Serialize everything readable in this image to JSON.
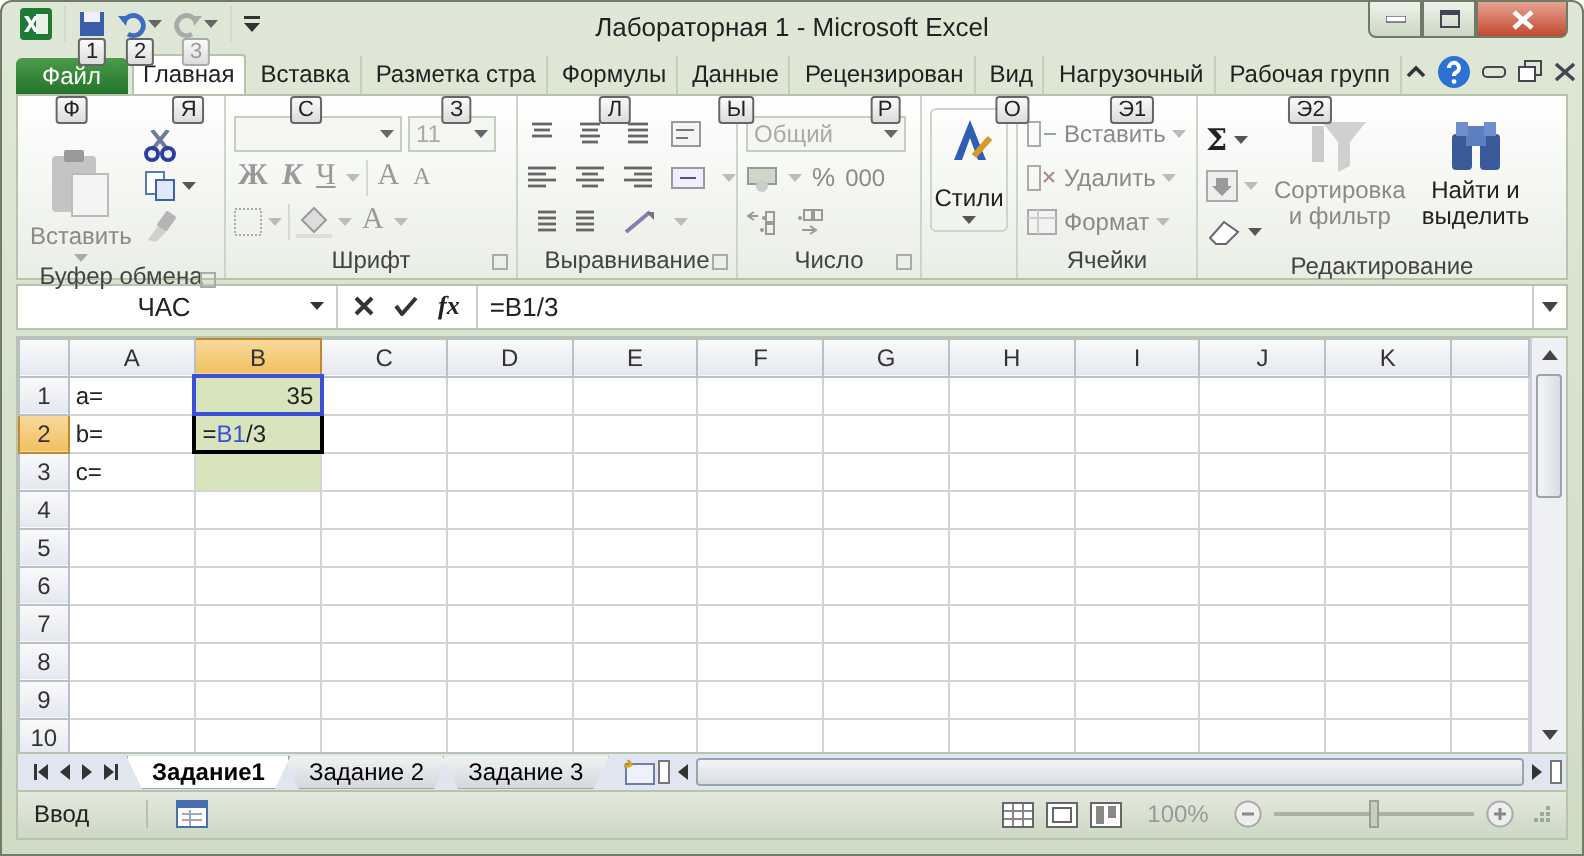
{
  "window": {
    "title": "Лабораторная 1  -  Microsoft Excel"
  },
  "quick_access": [
    {
      "kind": "save",
      "keytip": "1"
    },
    {
      "kind": "undo",
      "keytip": "2"
    },
    {
      "kind": "redo",
      "keytip": "3"
    }
  ],
  "tabs": [
    {
      "label": "Файл",
      "kind": "file",
      "keytip": "Ф",
      "selected": false
    },
    {
      "label": "Главная",
      "kind": "tab",
      "keytip": "Я",
      "selected": true
    },
    {
      "label": "Вставка",
      "kind": "tab",
      "keytip": "С",
      "selected": false
    },
    {
      "label": "Разметка стра",
      "kind": "tab",
      "keytip": "З",
      "selected": false
    },
    {
      "label": "Формулы",
      "kind": "tab",
      "keytip": "Л",
      "selected": false
    },
    {
      "label": "Данные",
      "kind": "tab",
      "keytip": "Ы",
      "selected": false
    },
    {
      "label": "Рецензирован",
      "kind": "tab",
      "keytip": "Р",
      "selected": false
    },
    {
      "label": "Вид",
      "kind": "tab",
      "keytip": "О",
      "selected": false
    },
    {
      "label": "Нагрузочный",
      "kind": "tab",
      "keytip": "Э1",
      "selected": false
    },
    {
      "label": "Рабочая групп",
      "kind": "tab",
      "keytip": "Э2",
      "selected": false
    }
  ],
  "ribbon": {
    "clipboard": {
      "title": "Буфер обмена",
      "paste": "Вставить"
    },
    "font": {
      "title": "Шрифт",
      "size": "11",
      "bold": "Ж",
      "italic": "К",
      "underline": "Ч",
      "grow": "A",
      "shrink": "A",
      "font_color": "A"
    },
    "alignment": {
      "title": "Выравнивание"
    },
    "number": {
      "title": "Число",
      "format": "Общий",
      "percent": "%",
      "thousands": "000"
    },
    "styles": {
      "label": "Стили"
    },
    "cells": {
      "title": "Ячейки",
      "items": [
        "Вставить",
        "Удалить",
        "Формат"
      ]
    },
    "editing": {
      "title": "Редактирование",
      "sum": "Σ",
      "sort": "Сортировка\nи фильтр",
      "find": "Найти и\nвыделить"
    }
  },
  "formula_bar": {
    "name_box": "ЧАС",
    "fx": "fx",
    "formula": "=B1/3"
  },
  "grid": {
    "columns": [
      {
        "label": "A",
        "selected": false
      },
      {
        "label": "B",
        "selected": true
      },
      {
        "label": "C",
        "selected": false
      },
      {
        "label": "D",
        "selected": false
      },
      {
        "label": "E",
        "selected": false
      },
      {
        "label": "F",
        "selected": false
      },
      {
        "label": "G",
        "selected": false
      },
      {
        "label": "H",
        "selected": false
      },
      {
        "label": "I",
        "selected": false
      },
      {
        "label": "J",
        "selected": false
      },
      {
        "label": "K",
        "selected": false
      }
    ],
    "rows": [
      {
        "label": "1",
        "selected": false,
        "cells": [
          {
            "kind": "text",
            "text": "a="
          },
          {
            "kind": "number",
            "text": "35",
            "color": "#d8e4bc",
            "referenced": true,
            "active": false
          }
        ]
      },
      {
        "label": "2",
        "selected": true,
        "cells": [
          {
            "kind": "text",
            "text": "b="
          },
          {
            "kind": "formula",
            "parts": [
              {
                "kind": "plain",
                "text": "="
              },
              {
                "kind": "reference",
                "text": "B1"
              },
              {
                "kind": "plain",
                "text": "/3"
              }
            ],
            "color": "#d8e4bc",
            "referenced": false,
            "active": true
          }
        ]
      },
      {
        "label": "3",
        "selected": false,
        "cells": [
          {
            "kind": "text",
            "text": "c="
          },
          {
            "kind": "empty",
            "color": "#d8e4bc",
            "referenced": false,
            "active": false
          }
        ]
      },
      {
        "label": "4",
        "selected": false,
        "cells": []
      },
      {
        "label": "5",
        "selected": false,
        "cells": []
      },
      {
        "label": "6",
        "selected": false,
        "cells": []
      },
      {
        "label": "7",
        "selected": false,
        "cells": []
      },
      {
        "label": "8",
        "selected": false,
        "cells": []
      },
      {
        "label": "9",
        "selected": false,
        "cells": []
      },
      {
        "label": "10",
        "selected": false,
        "cells": []
      }
    ]
  },
  "sheets": [
    {
      "label": "Задание1",
      "selected": true
    },
    {
      "label": "Задание 2",
      "selected": false
    },
    {
      "label": "Задание 3",
      "selected": false
    }
  ],
  "status_bar": {
    "mode": "Ввод",
    "zoom": "100%",
    "zoom_slider": {
      "level": 0.5
    }
  }
}
